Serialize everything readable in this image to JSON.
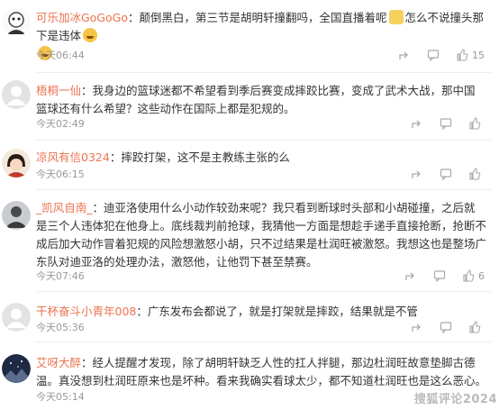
{
  "comments": [
    {
      "user": "可乐加冰GoGoGo",
      "text_a": "颠倒黑白，第三节是胡明轩撞翻吗，全国直播着呢",
      "text_b": "怎么不说撞头那下是违体",
      "time": "今天06:44",
      "likes": "15"
    },
    {
      "user": "梧桐一仙",
      "text": "我身边的篮球迷都不希望看到季后赛变成摔跤比赛，变成了武术大战，那中国篮球还有什么希望？这些动作在国际上都是犯规的。",
      "time": "今天02:49",
      "likes": ""
    },
    {
      "user": "凉风有信0324",
      "text": "摔跤打架，这不是主教练主张的么",
      "time": "今天06:15",
      "likes": ""
    },
    {
      "user": "_凯风自南_",
      "text": "迪亚洛使用什么小动作较劲来呢？我只看到断球时头部和小胡碰撞，之后就是三个人违体犯在他身上。底线裁判前抢球，我猜他一方面是想趁手递手直接抢断，抢断不成后加大动作冒着犯规的风险想激怒小胡，只不过结果是杜润旺被激怒。我想这也是整场广东队对迪亚洛的处理办法，激怒他，让他罚下甚至禁赛。",
      "time": "今天07:46",
      "likes": "6"
    },
    {
      "user": "干杯奋斗小青年008",
      "text": "广东发布会都说了，就是打架就是摔跤，结果就是不管",
      "time": "今天05:36",
      "likes": ""
    },
    {
      "user": "艾呀大醉",
      "text": "经人提醒才发现，除了胡明轩缺乏人性的扛人拌腿，那边杜润旺故意垫脚古德温。真没想到杜润旺原来也是坏种。看来我确实看球太少，都不知道杜润旺也是这么恶心。",
      "time": "今天05:14",
      "likes": ""
    }
  ],
  "sep": "：",
  "watermark": "搜狐评论2024",
  "colors": {
    "username": "#eb7350",
    "meta": "#999999",
    "text": "#333333"
  },
  "icons": [
    "share-icon",
    "comment-icon",
    "like-icon"
  ]
}
